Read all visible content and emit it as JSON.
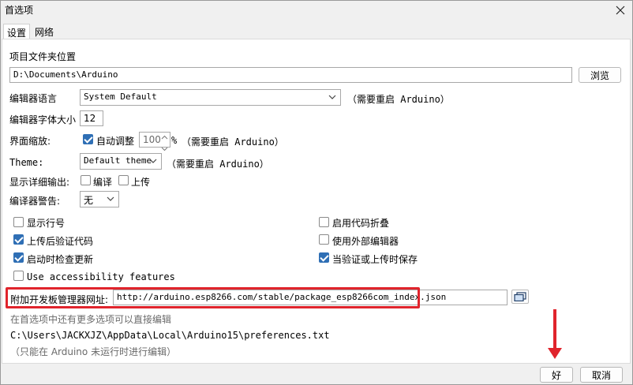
{
  "window": {
    "title": "首选项"
  },
  "tabs": [
    {
      "label": "设置",
      "active": true
    },
    {
      "label": "网络",
      "active": false
    }
  ],
  "settings": {
    "sketchbook_label": "项目文件夹位置",
    "sketchbook_path": "D:\\Documents\\Arduino",
    "browse_label": "浏览",
    "language_label": "编辑器语言",
    "language_value": "System Default",
    "language_note": "（需要重启 Arduino）",
    "font_size_label": "编辑器字体大小",
    "font_size_value": "12",
    "scale_label": "界面缩放:",
    "scale_auto_label": "自动调整",
    "scale_auto_checked": true,
    "scale_value": "100",
    "scale_unit": "%",
    "scale_note": "（需要重启 Arduino）",
    "theme_label": "Theme:",
    "theme_value": "Default theme",
    "theme_note": "（需要重启 Arduino）",
    "verbose_label": "显示详细输出:",
    "verbose_compile_label": "编译",
    "verbose_compile_checked": false,
    "verbose_upload_label": "上传",
    "verbose_upload_checked": false,
    "warnings_label": "编译器警告:",
    "warnings_value": "无",
    "options_left": [
      {
        "label": "显示行号",
        "checked": false
      },
      {
        "label": "上传后验证代码",
        "checked": true
      },
      {
        "label": "启动时检查更新",
        "checked": true
      },
      {
        "label": "Use accessibility features",
        "checked": false
      }
    ],
    "options_right": [
      {
        "label": "启用代码折叠",
        "checked": false
      },
      {
        "label": "使用外部编辑器",
        "checked": false
      },
      {
        "label": "当验证或上传时保存",
        "checked": true
      }
    ],
    "board_urls_label": "附加开发板管理器网址:",
    "board_urls_value": "http://arduino.esp8266.com/stable/package_esp8266com_index.json",
    "more_prefs_note": "在首选项中还有更多选项可以直接编辑",
    "prefs_path": "C:\\Users\\JACKXJZ\\AppData\\Local\\Arduino15\\preferences.txt",
    "edit_note": "（只能在 Arduino 未运行时进行编辑）"
  },
  "footer": {
    "ok_label": "好",
    "cancel_label": "取消"
  },
  "colors": {
    "highlight": "#e0242c",
    "accent": "#2f6fb5"
  }
}
